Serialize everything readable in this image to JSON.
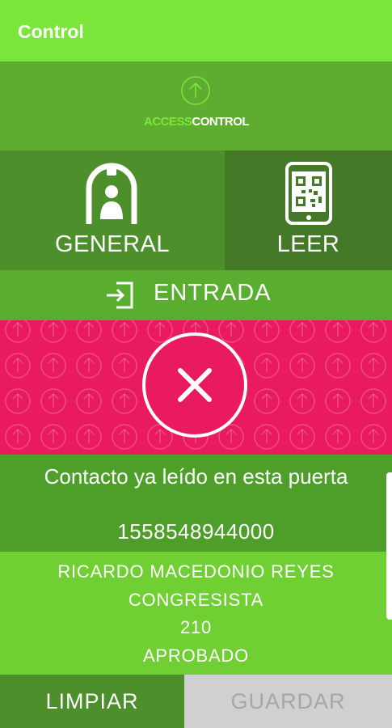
{
  "app": {
    "title": "Control"
  },
  "logo": {
    "part1": "ACCESS",
    "part2": "CONTROL"
  },
  "modes": {
    "general_label": "GENERAL",
    "leer_label": "LEER"
  },
  "direction": {
    "label": "ENTRADA"
  },
  "result": {
    "status": "error",
    "message": "Contacto ya leído en esta puerta",
    "code": "1558548944000"
  },
  "contact": {
    "name": "RICARDO MACEDONIO REYES",
    "role": "CONGRESISTA",
    "number": "210",
    "status": "APROBADO"
  },
  "actions": {
    "clear_label": "LIMPIAR",
    "save_label": "GUARDAR"
  },
  "colors": {
    "topbar": "#7ae63a",
    "error": "#e91a5e",
    "brand": "#7ae63a"
  }
}
